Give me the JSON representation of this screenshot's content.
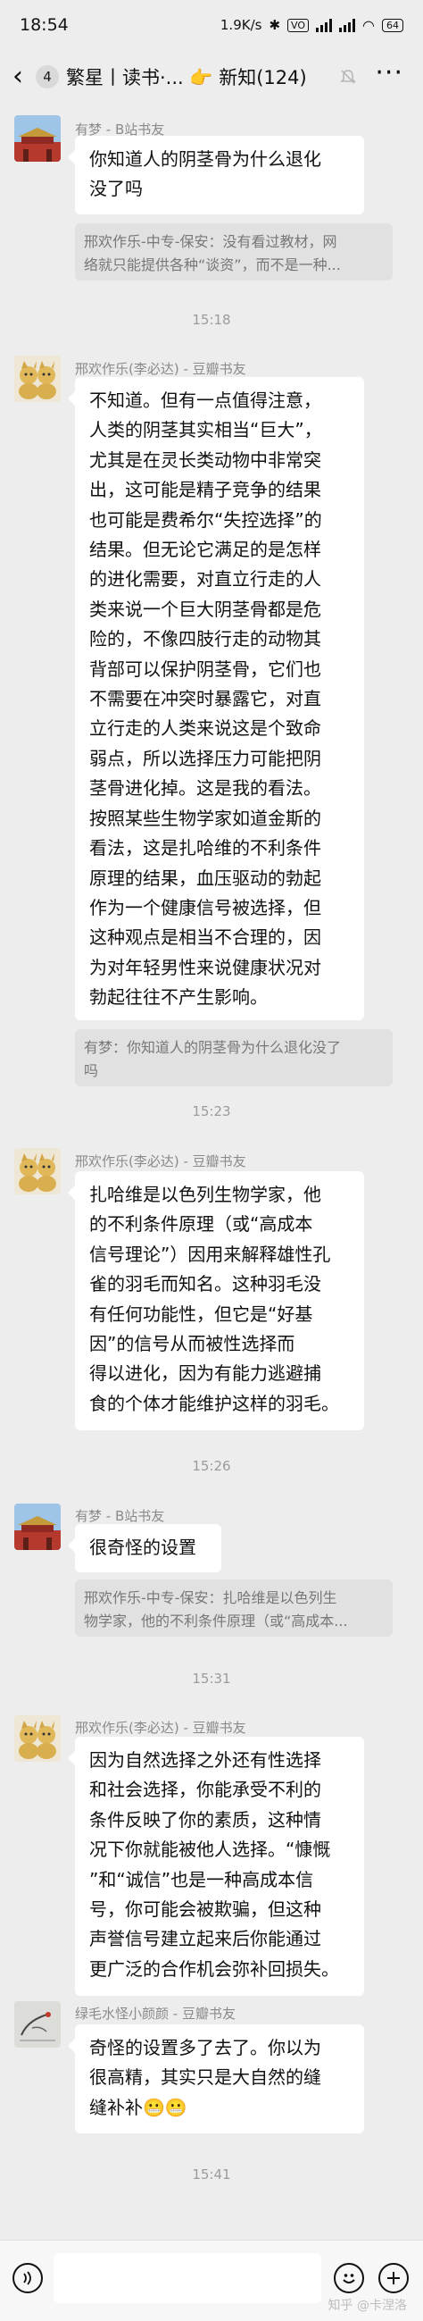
{
  "status_bar": {
    "time": "18:54",
    "network_speed": "1.9K/s",
    "battery": "64"
  },
  "header": {
    "back_icon": "chevron-left-icon",
    "unread_count": "4",
    "title": "繁星丨读书·... 👉 新知(124)"
  },
  "messages": [
    {
      "sender": "有梦 - B站书友",
      "avatar": "palace-avatar",
      "lines": [
        "你知道人的阴茎骨为什么退化",
        "没了吗"
      ],
      "quote": [
        "邢欢作乐-中专-保安：没有看过教材，网",
        "络就只能提供各种“谈资”，而不是一种..."
      ]
    },
    {
      "timestamp": "15:18"
    },
    {
      "sender": "邢欢作乐(李必达) - 豆瓣书友",
      "avatar": "kitten-figurine-avatar",
      "lines": [
        "不知道。但有一点值得注意，",
        "人类的阴茎其实相当“巨大”，",
        "尤其是在灵长类动物中非常突",
        "出，这可能是精子竞争的结果",
        "也可能是费希尔“失控选择”的",
        "结果。但无论它满足的是怎样",
        "的进化需要，对直立行走的人",
        "类来说一个巨大阴茎骨都是危",
        "险的，不像四肢行走的动物其",
        "背部可以保护阴茎骨，它们也",
        "不需要在冲突时暴露它，对直",
        "立行走的人类来说这是个致命",
        "弱点，所以选择压力可能把阴",
        "茎骨进化掉。这是我的看法。",
        "按照某些生物学家如道金斯的",
        "看法，这是扎哈维的不利条件",
        "原理的结果，血压驱动的勃起",
        "作为一个健康信号被选择，但",
        "这种观点是相当不合理的，因",
        "为对年轻男性来说健康状况对",
        "勃起往往不产生影响。"
      ],
      "quote": [
        "有梦：你知道人的阴茎骨为什么退化没了",
        "吗"
      ]
    },
    {
      "timestamp": "15:23"
    },
    {
      "sender": "邢欢作乐(李必达) - 豆瓣书友",
      "avatar": "kitten-figurine-avatar",
      "lines": [
        "扎哈维是以色列生物学家，他",
        "的不利条件原理（或“高成本",
        "信号理论”）因用来解释雄性孔",
        "雀的羽毛而知名。这种羽毛没",
        "有任何功能性，但它是“好基",
        "因”的信号从而被性选择而",
        "得以进化，因为有能力逃避捕",
        "食的个体才能维护这样的羽毛。"
      ]
    },
    {
      "timestamp": "15:26"
    },
    {
      "sender": "有梦 - B站书友",
      "avatar": "palace-avatar",
      "lines": [
        "很奇怪的设置"
      ],
      "quote": [
        "邢欢作乐-中专-保安：扎哈维是以色列生",
        "物学家，他的不利条件原理（或“高成本..."
      ]
    },
    {
      "timestamp": "15:31"
    },
    {
      "sender": "邢欢作乐(李必达) - 豆瓣书友",
      "avatar": "kitten-figurine-avatar",
      "lines": [
        "因为自然选择之外还有性选择",
        "和社会选择，你能承受不利的",
        "条件反映了你的素质，这种情",
        "况下你就能被他人选择。“慷慨",
        "”和“诚信”也是一种高成本信",
        "号，你可能会被欺骗，但这种",
        "声誉信号建立起来后你能通过",
        "更广泛的合作机会弥补回损失。"
      ]
    },
    {
      "sender": "绿毛水怪小颜颜 - 豆瓣书友",
      "avatar": "bird-sketch-avatar",
      "lines": [
        "奇怪的设置多了去了。你以为",
        "很高精，其实只是大自然的缝",
        "缝补补😬😬"
      ]
    },
    {
      "timestamp": "15:41"
    }
  ],
  "input_bar": {
    "voice_icon": "voice-icon",
    "emoji_icon": "emoji-icon",
    "plus_icon": "plus-icon"
  },
  "watermark": "知乎 @卡涅洛"
}
